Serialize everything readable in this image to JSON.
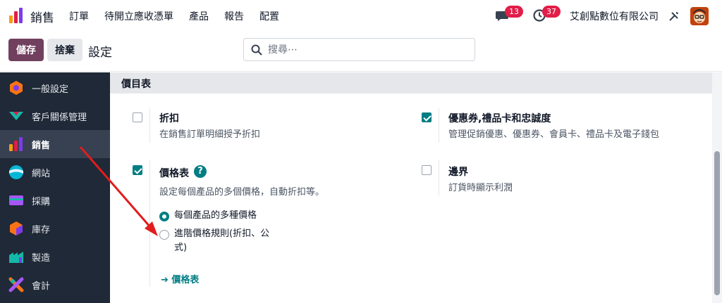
{
  "topbar": {
    "app_name": "銷售",
    "menu": [
      "訂單",
      "待開立應收憑單",
      "產品",
      "報告",
      "配置"
    ],
    "messages_count": "13",
    "activities_count": "37",
    "company": "艾創點數位有限公司"
  },
  "control": {
    "save_label": "儲存",
    "discard_label": "捨棄",
    "title": "設定",
    "search_placeholder": "搜尋⋯"
  },
  "sidebar": {
    "items": [
      {
        "label": "一般設定",
        "icon": "general-settings-icon",
        "color": "#f97316"
      },
      {
        "label": "客戶關係管理",
        "icon": "crm-icon",
        "color": "#14b8a6"
      },
      {
        "label": "銷售",
        "icon": "sales-icon",
        "color": "#f59e0b"
      },
      {
        "label": "網站",
        "icon": "website-icon",
        "color": "#06b6d4"
      },
      {
        "label": "採購",
        "icon": "purchase-icon",
        "color": "#a855f7"
      },
      {
        "label": "庫存",
        "icon": "inventory-icon",
        "color": "#f97316"
      },
      {
        "label": "製造",
        "icon": "manufacturing-icon",
        "color": "#14b8a6"
      },
      {
        "label": "會計",
        "icon": "accounting-icon",
        "color": "#f97316"
      }
    ],
    "active_index": 2
  },
  "section": {
    "title": "價目表",
    "settings": [
      {
        "title": "折扣",
        "desc": "在銷售訂單明細授予折扣",
        "checked": false
      },
      {
        "title": "優惠券,禮品卡和忠誠度",
        "desc": "管理促銷優惠、優惠券、會員卡、禮品卡及電子錢包",
        "checked": true
      },
      {
        "title": "價格表",
        "desc": "設定每個產品的多個價格，自動折扣等。",
        "checked": true
      },
      {
        "title": "邊界",
        "desc": "訂貨時顯示利潤",
        "checked": false
      }
    ],
    "pricelist_options": [
      {
        "label": "每個產品的多種價格",
        "selected": true
      },
      {
        "label": "進階價格規則(折扣、公式)",
        "selected": false
      }
    ],
    "pricelist_link": "價格表"
  },
  "colors": {
    "brand": "#71405e",
    "accent": "#017e84",
    "sidebar_bg": "#1f2937",
    "badge": "#e11d48",
    "annotation_arrow": "#e11d1d"
  }
}
